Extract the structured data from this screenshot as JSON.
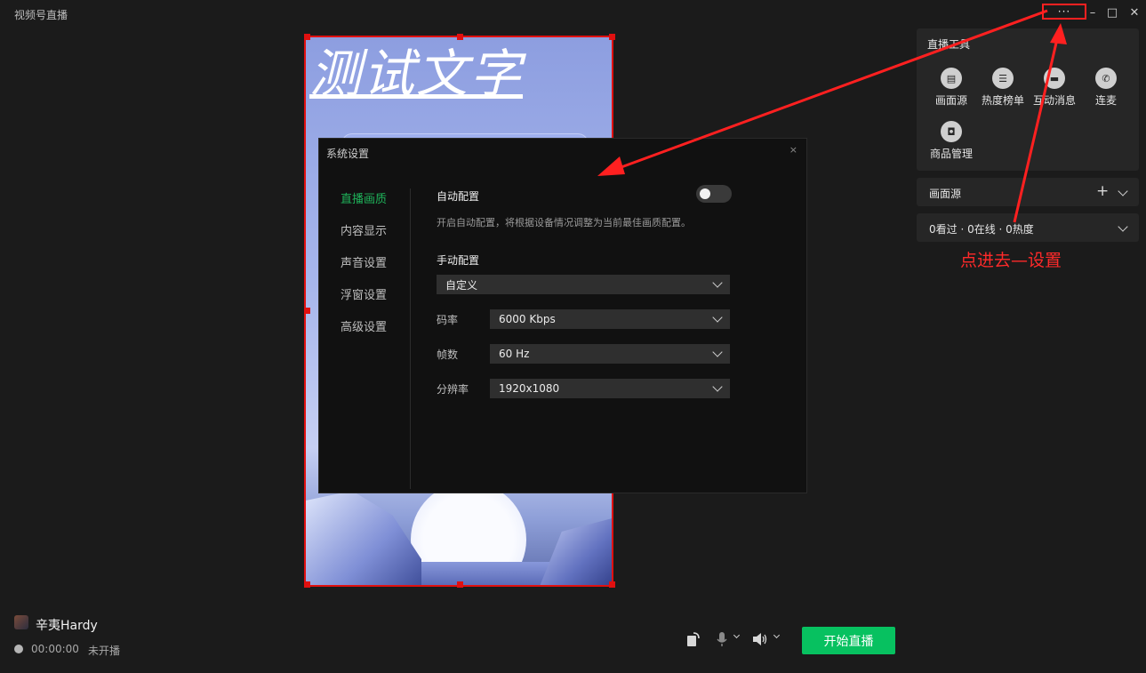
{
  "app": {
    "title": "视频号直播"
  },
  "window_controls": {
    "more": "···",
    "minimize": "–",
    "maximize": "□",
    "close": "✕"
  },
  "preview": {
    "overlay_text": "测试文字"
  },
  "settings_dialog": {
    "title": "系统设置",
    "close": "×",
    "nav": [
      {
        "label": "直播画质",
        "active": true
      },
      {
        "label": "内容显示",
        "active": false
      },
      {
        "label": "声音设置",
        "active": false
      },
      {
        "label": "浮窗设置",
        "active": false
      },
      {
        "label": "高级设置",
        "active": false
      }
    ],
    "auto_config": {
      "label": "自动配置",
      "enabled": false,
      "description": "开启自动配置，将根据设备情况调整为当前最佳画质配置。"
    },
    "manual_config": {
      "label": "手动配置",
      "preset": "自定义",
      "bitrate": {
        "label": "码率",
        "value": "6000 Kbps"
      },
      "fps": {
        "label": "帧数",
        "value": "60 Hz"
      },
      "resolution": {
        "label": "分辨率",
        "value": "1920x1080"
      }
    }
  },
  "live_tools": {
    "title": "直播工具",
    "items": [
      {
        "label": "画面源",
        "icon": "document-icon"
      },
      {
        "label": "热度榜单",
        "icon": "list-icon"
      },
      {
        "label": "互动消息",
        "icon": "chat-icon"
      },
      {
        "label": "连麦",
        "icon": "phone-icon"
      },
      {
        "label": "商品管理",
        "icon": "bag-icon"
      }
    ]
  },
  "source_bar": {
    "label": "画面源",
    "add": "+"
  },
  "stats_bar": {
    "label": "0看过 · 0在线 · 0热度"
  },
  "annotation": {
    "text": "点进去—设置",
    "color": "#ff2a2a"
  },
  "footer": {
    "user_name": "辛夷Hardy",
    "live_time": "00:00:00",
    "live_status": "未开播",
    "start_button": "开始直播"
  },
  "colors": {
    "accent": "#07c160",
    "active_nav": "#1fb35a",
    "highlight": "#e01010"
  }
}
